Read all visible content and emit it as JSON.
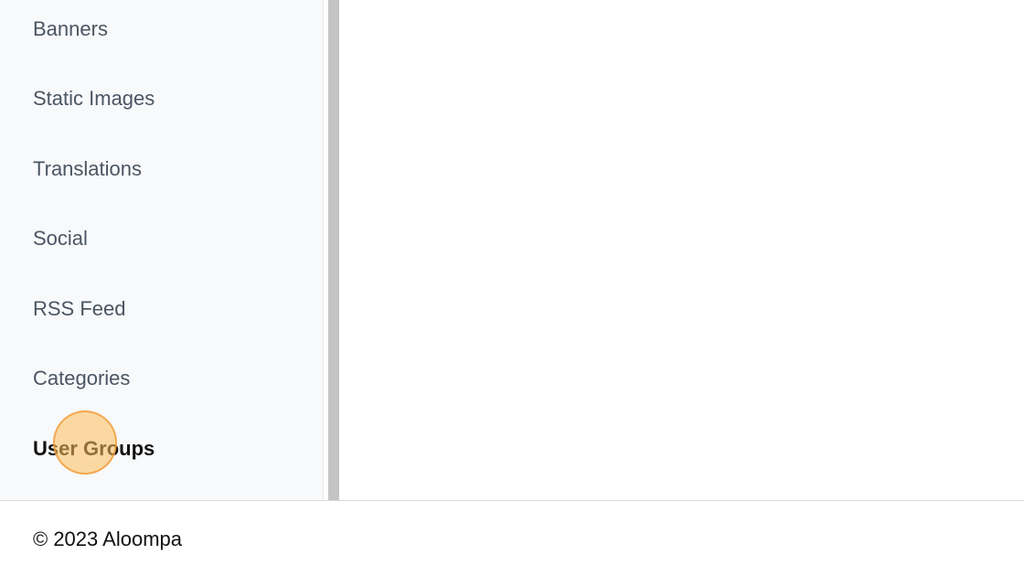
{
  "sidebar": {
    "items": [
      {
        "label": "Banners"
      },
      {
        "label": "Static Images"
      },
      {
        "label": "Translations"
      },
      {
        "label": "Social"
      },
      {
        "label": "RSS Feed"
      },
      {
        "label": "Categories"
      },
      {
        "label": "User Groups",
        "active": true
      }
    ]
  },
  "footer": {
    "copyright": "© 2023 Aloompa"
  },
  "colors": {
    "sidebar_bg": "#f7f9fb",
    "splitter": "#c4c4c4",
    "item_text": "#4b5563",
    "active_text": "#111111",
    "click_indicator": "#ffbe5a"
  }
}
